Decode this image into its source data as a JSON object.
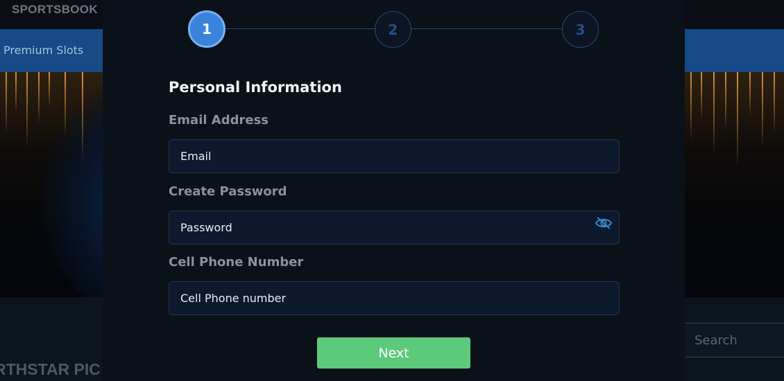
{
  "background": {
    "brand": "SPORTSBOOK",
    "nav_item": "Premium Slots",
    "search_placeholder": "Search",
    "section_heading": "RTHSTAR PIC"
  },
  "stepper": {
    "steps": [
      "1",
      "2",
      "3"
    ],
    "current_step": 1
  },
  "form": {
    "title": "Personal Information",
    "email_label": "Email Address",
    "email_placeholder": "Email",
    "password_label": "Create Password",
    "password_placeholder": "Password",
    "phone_label": "Cell Phone Number",
    "phone_placeholder": "Cell Phone number",
    "next_label": "Next"
  },
  "colors": {
    "accent_blue": "#3a83dc",
    "button_green": "#5cc97b",
    "nav_blue": "#174a86"
  },
  "icons": {
    "password_toggle": "eye-slash-icon"
  }
}
